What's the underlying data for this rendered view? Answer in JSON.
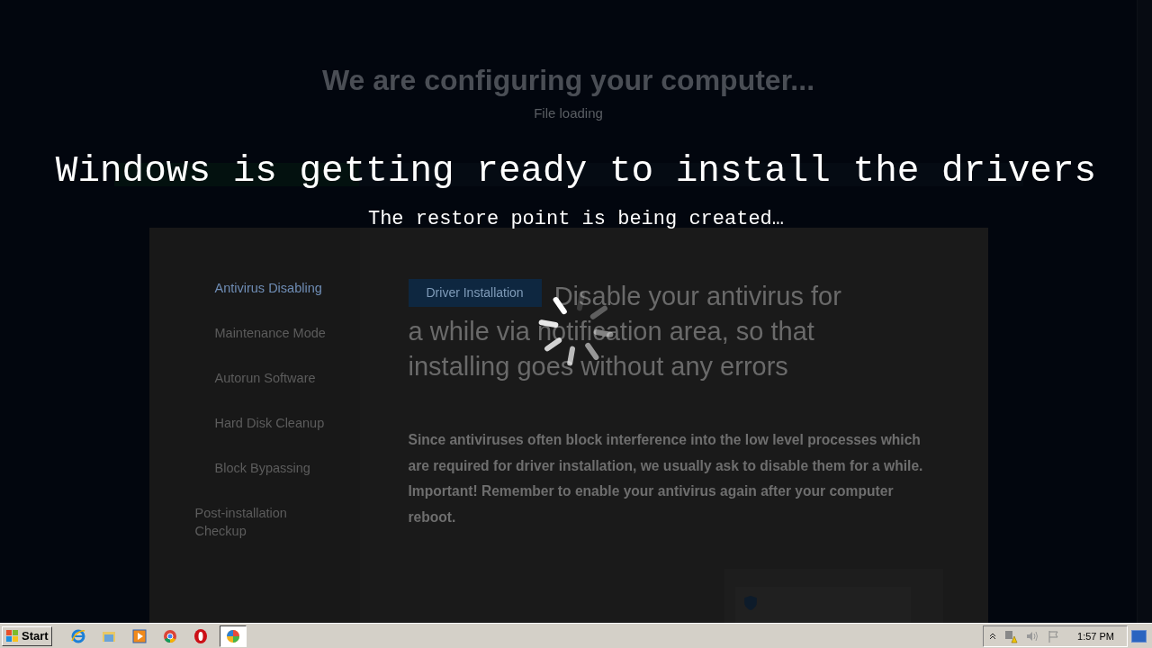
{
  "page": {
    "title": "We are configuring your computer...",
    "subtitle": "File loading",
    "progress": {
      "level": 0.27
    }
  },
  "overlay": {
    "title": "Windows is getting ready to install the drivers",
    "subtitle": "The restore point is being created…"
  },
  "sidebar": {
    "items": [
      {
        "label": "Antivirus Disabling",
        "selected": true
      },
      {
        "label": "Maintenance Mode",
        "selected": false
      },
      {
        "label": "Autorun Software",
        "selected": false
      },
      {
        "label": "Hard Disk Cleanup",
        "selected": false
      },
      {
        "label": "Block Bypassing",
        "selected": false
      },
      {
        "label": "Post-installation Checkup",
        "selected": false
      }
    ]
  },
  "step": {
    "badge": "Driver Installation",
    "heading_lines": [
      "Disable your antivirus for",
      "a while via notification area, so that",
      "installing goes without any errors"
    ],
    "text": "Since antiviruses often block interference into the low level processes which are required for driver installation, we usually ask to disable them for a while. Important! Remember to enable your antivirus again after your computer reboot."
  },
  "taskbar": {
    "start": "Start",
    "apps": [
      {
        "kind": "ie",
        "selected": false
      },
      {
        "kind": "folder",
        "selected": false
      },
      {
        "kind": "media",
        "selected": false
      },
      {
        "kind": "chrome",
        "selected": false
      },
      {
        "kind": "opera",
        "selected": false
      },
      {
        "kind": "installer",
        "selected": true
      }
    ],
    "clock": "1:57 PM"
  }
}
